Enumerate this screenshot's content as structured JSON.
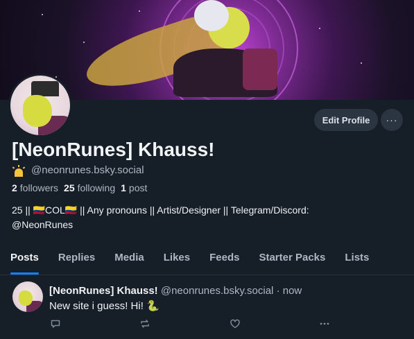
{
  "profile": {
    "display_name": "[NeonRunes] Khauss!",
    "handle": "@neonrunes.bsky.social",
    "followers_count": "2",
    "followers_label": "followers",
    "following_count": "25",
    "following_label": "following",
    "posts_count": "1",
    "posts_label": "post",
    "bio_line1": "25 || 🇨🇴COL🇨🇴 || Any pronouns || Artist/Designer || Telegram/Discord:",
    "bio_line2": "@NeonRunes",
    "handle_icon": "sunrise-icon"
  },
  "actions": {
    "edit_profile_label": "Edit Profile",
    "more_label": "···"
  },
  "tabs": [
    {
      "label": "Posts",
      "active": true
    },
    {
      "label": "Replies",
      "active": false
    },
    {
      "label": "Media",
      "active": false
    },
    {
      "label": "Likes",
      "active": false
    },
    {
      "label": "Feeds",
      "active": false
    },
    {
      "label": "Starter Packs",
      "active": false
    },
    {
      "label": "Lists",
      "active": false
    }
  ],
  "post": {
    "author_name": "[NeonRunes] Khauss!",
    "author_handle": "@neonrunes.bsky.social",
    "separator": "·",
    "timestamp": "now",
    "text": "New site i guess! Hi! 🐍",
    "actions": [
      "reply-icon",
      "repost-icon",
      "like-icon",
      "more-icon"
    ]
  },
  "colors": {
    "background": "#161e27",
    "accent": "#1083fe",
    "muted_text": "#aeb8c4",
    "button_bg": "#2b3542"
  }
}
